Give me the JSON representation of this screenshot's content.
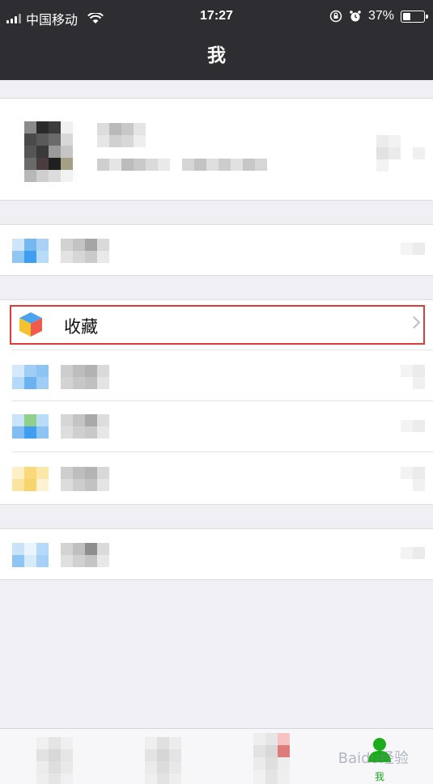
{
  "status_bar": {
    "carrier": "中国移动",
    "time": "17:27",
    "battery_percent": "37%"
  },
  "nav": {
    "title": "我"
  },
  "menu": {
    "favorites_label": "收藏"
  },
  "tab_bar": {
    "me_label": "我",
    "watermark": "Baidu经验"
  },
  "colors": {
    "header_bg": "#2e2e32",
    "accent_green": "#1aad19",
    "highlight_red": "#e03a3a"
  }
}
